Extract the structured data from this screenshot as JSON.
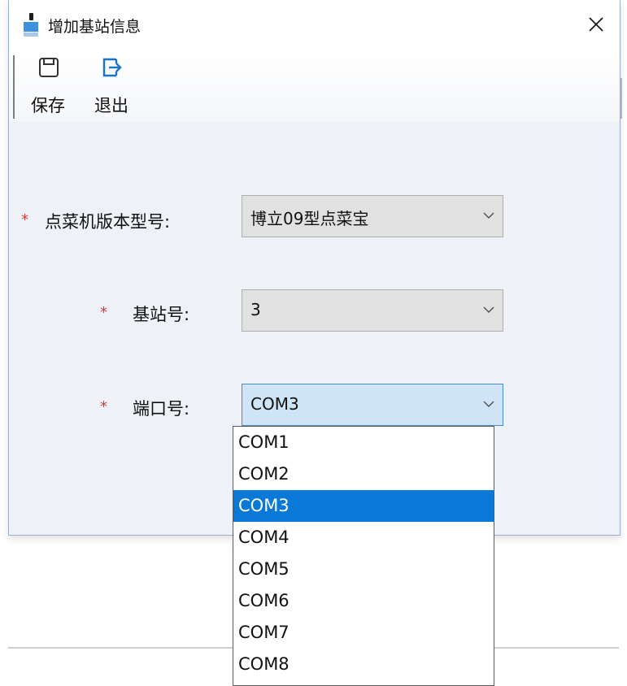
{
  "window": {
    "title": "增加基站信息"
  },
  "toolbar": {
    "save_label": "保存",
    "exit_label": "退出"
  },
  "form": {
    "model": {
      "label": "点菜机版本型号:",
      "value": "博立09型点菜宝"
    },
    "station": {
      "label": "基站号:",
      "value": "3"
    },
    "port": {
      "label": "端口号:",
      "value": "COM3"
    }
  },
  "required_mark": "*",
  "port_options": [
    "COM1",
    "COM2",
    "COM3",
    "COM4",
    "COM5",
    "COM6",
    "COM7",
    "COM8"
  ],
  "port_selected": "COM3",
  "colors": {
    "accent": "#0a78d7",
    "required": "#d43b3b",
    "exit_icon": "#1b73c9"
  }
}
